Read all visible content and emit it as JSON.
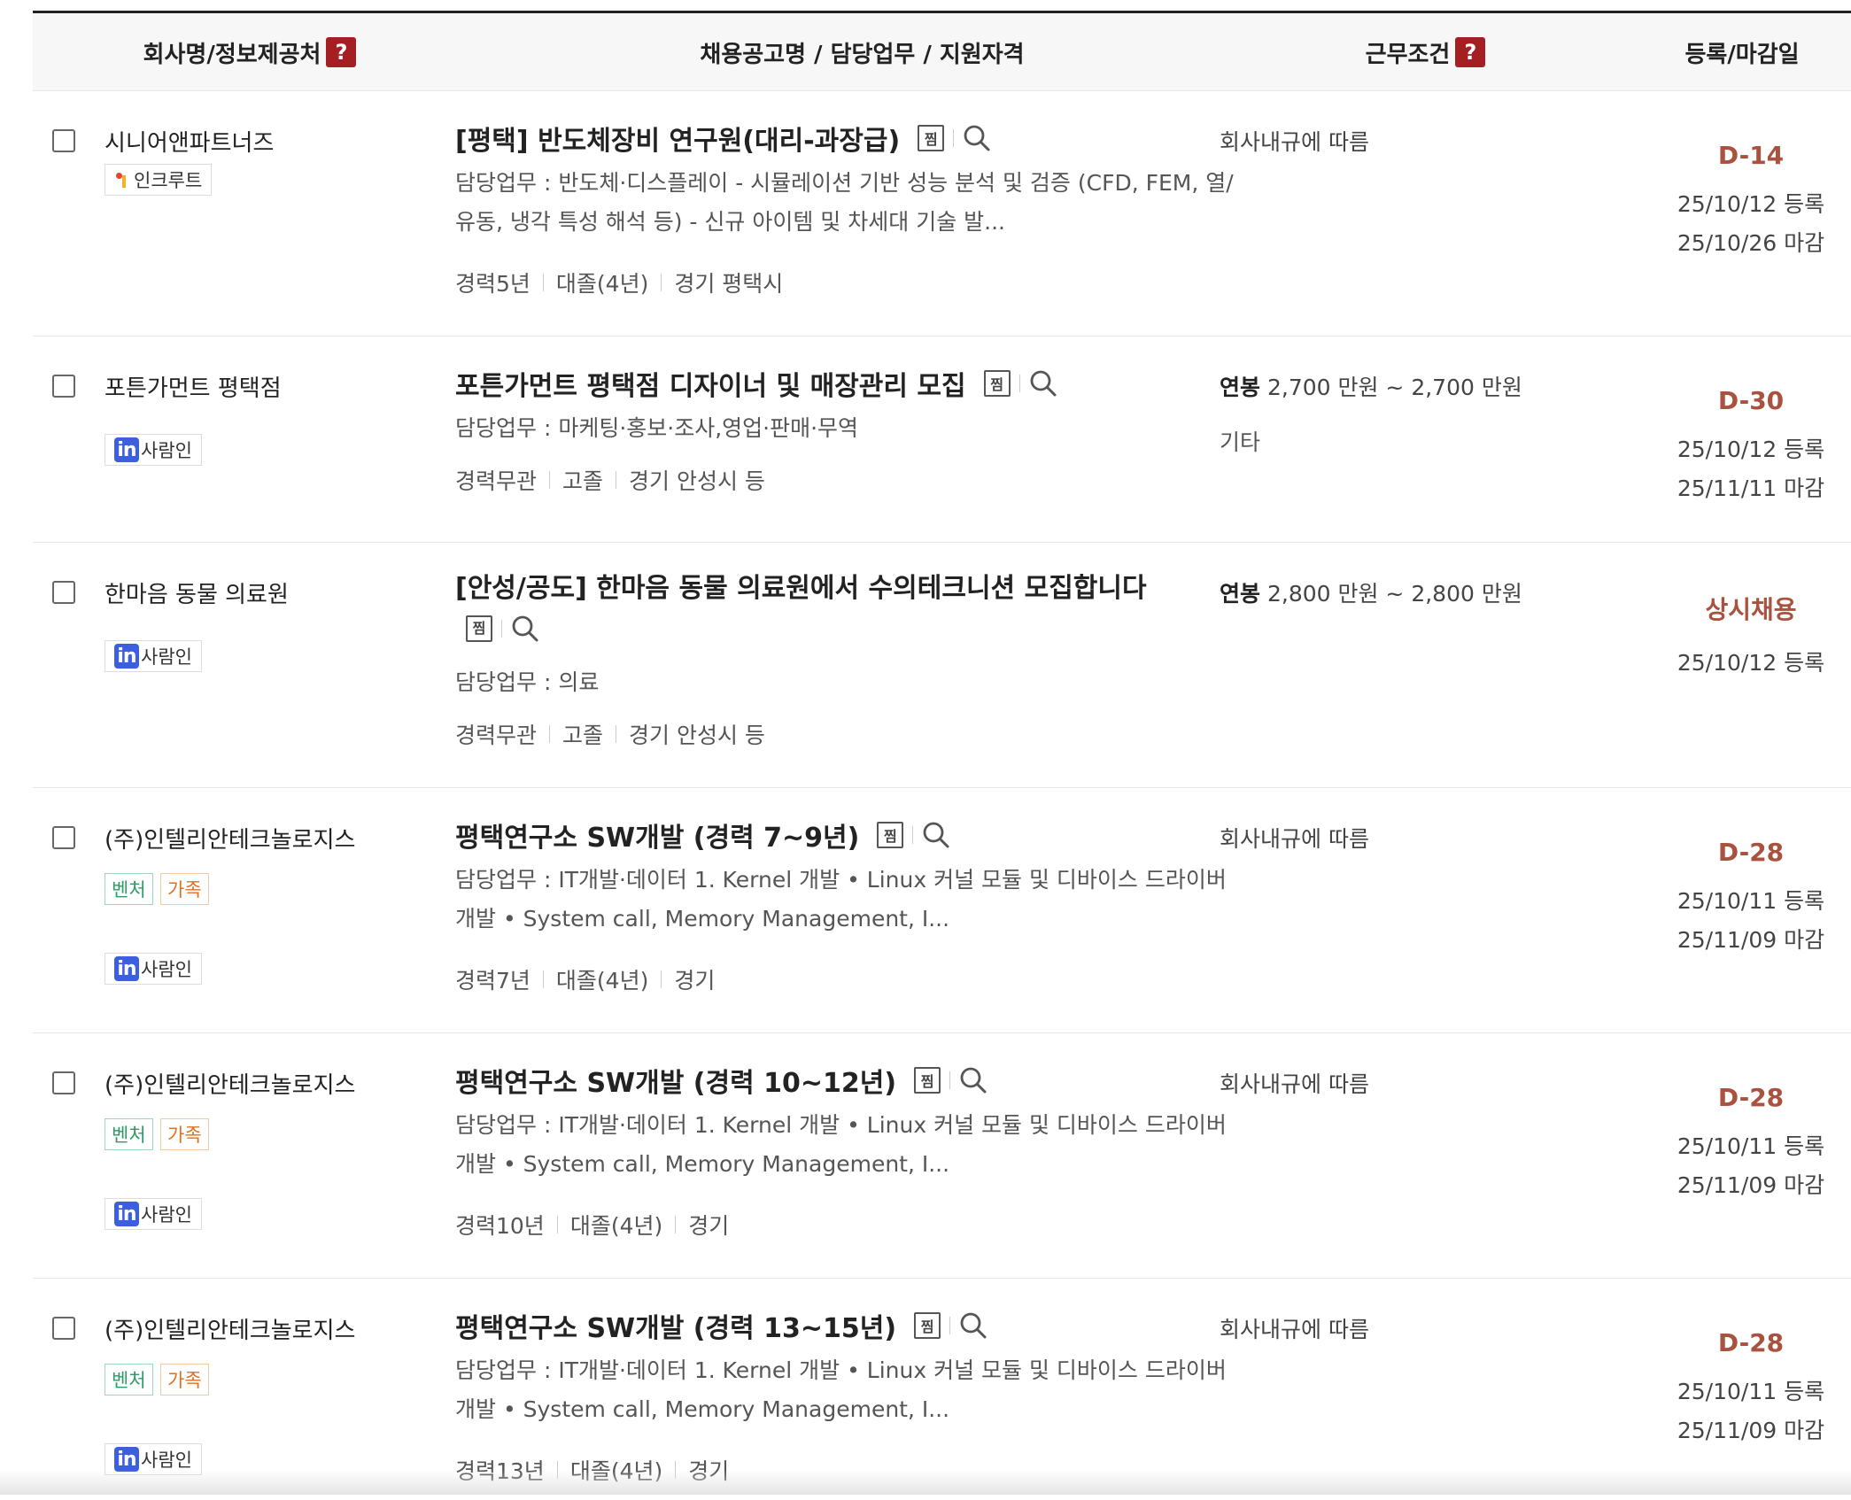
{
  "header": {
    "company": "회사명/정보제공처",
    "title": "채용공고명 / 담당업무 / 지원자격",
    "conditions": "근무조건",
    "dates": "등록/마감일",
    "help": "?"
  },
  "scrap_label": "찜",
  "rows": [
    {
      "company": "시니어앤파트너즈",
      "source": "인크루트",
      "tags": [],
      "title": "[평택] 반도체장비 연구원(대리-과장급)",
      "duty": "담당업무 : 반도체·디스플레이 - 시뮬레이션 기반 성능 분석 및 검증 (CFD, FEM, 열/유동, 냉각 특성 해석 등) - 신규 아이템 및 차세대 기술 발...",
      "meta": [
        "경력5년",
        "대졸(4년)",
        "경기 평택시"
      ],
      "salary_label": "",
      "salary": "회사내규에 따름",
      "extra": "",
      "deadline": "D-14",
      "registered": "25/10/12 등록",
      "closing": "25/10/26 마감"
    },
    {
      "company": "포튼가먼트 평택점",
      "source": "사람인",
      "tags": [],
      "title": "포튼가먼트 평택점 디자이너 및 매장관리 모집",
      "duty": "담당업무 : 마케팅·홍보·조사,영업·판매·무역",
      "meta": [
        "경력무관",
        "고졸",
        "경기 안성시 등"
      ],
      "salary_label": "연봉",
      "salary": "2,700 만원 ~ 2,700 만원",
      "extra": "기타",
      "deadline": "D-30",
      "registered": "25/10/12 등록",
      "closing": "25/11/11 마감"
    },
    {
      "company": "한마음 동물 의료원",
      "source": "사람인",
      "tags": [],
      "title": "[안성/공도] 한마음 동물 의료원에서 수의테크니션 모집합니다",
      "duty": "담당업무 : 의료",
      "meta": [
        "경력무관",
        "고졸",
        "경기 안성시 등"
      ],
      "salary_label": "연봉",
      "salary": "2,800 만원 ~ 2,800 만원",
      "extra": "",
      "deadline": "상시채용",
      "registered": "25/10/12 등록",
      "closing": ""
    },
    {
      "company": "(주)인텔리안테크놀로지스",
      "source": "사람인",
      "tags": [
        "벤처",
        "가족"
      ],
      "title": "평택연구소 SW개발 (경력 7~9년)",
      "duty": "담당업무 : IT개발·데이터 1. Kernel 개발 • Linux 커널 모듈 및 디바이스 드라이버 개발 • System call, Memory Management, I...",
      "meta": [
        "경력7년",
        "대졸(4년)",
        "경기"
      ],
      "salary_label": "",
      "salary": "회사내규에 따름",
      "extra": "",
      "deadline": "D-28",
      "registered": "25/10/11 등록",
      "closing": "25/11/09 마감"
    },
    {
      "company": "(주)인텔리안테크놀로지스",
      "source": "사람인",
      "tags": [
        "벤처",
        "가족"
      ],
      "title": "평택연구소 SW개발 (경력 10~12년)",
      "duty": "담당업무 : IT개발·데이터 1. Kernel 개발 • Linux 커널 모듈 및 디바이스 드라이버 개발 • System call, Memory Management, I...",
      "meta": [
        "경력10년",
        "대졸(4년)",
        "경기"
      ],
      "salary_label": "",
      "salary": "회사내규에 따름",
      "extra": "",
      "deadline": "D-28",
      "registered": "25/10/11 등록",
      "closing": "25/11/09 마감"
    },
    {
      "company": "(주)인텔리안테크놀로지스",
      "source": "사람인",
      "tags": [
        "벤처",
        "가족"
      ],
      "title": "평택연구소 SW개발 (경력 13~15년)",
      "duty": "담당업무 : IT개발·데이터 1. Kernel 개발 • Linux 커널 모듈 및 디바이스 드라이버 개발 • System call, Memory Management, I...",
      "meta": [
        "경력13년",
        "대졸(4년)",
        "경기"
      ],
      "salary_label": "",
      "salary": "회사내규에 따름",
      "extra": "",
      "deadline": "D-28",
      "registered": "25/10/11 등록",
      "closing": "25/11/09 마감"
    }
  ]
}
